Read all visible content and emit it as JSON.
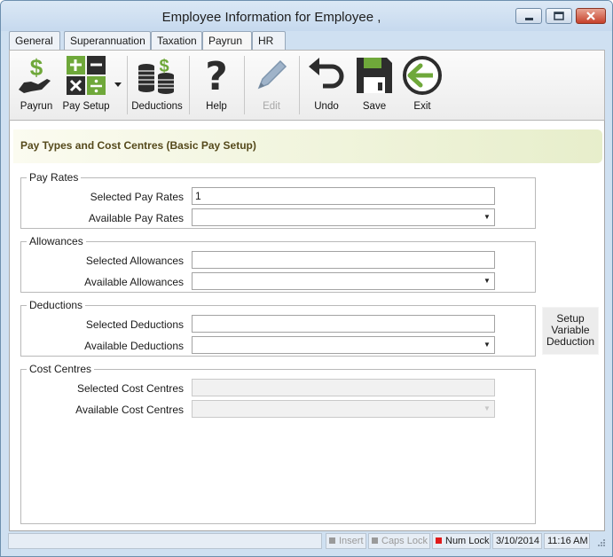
{
  "window": {
    "title": "Employee Information for  Employee ,",
    "controls": [
      "minimize",
      "maximize",
      "close"
    ]
  },
  "tabs": [
    {
      "label": "General",
      "active": false
    },
    {
      "label": "Superannuation",
      "active": false
    },
    {
      "label": "Taxation",
      "active": false
    },
    {
      "label": "Payrun",
      "active": true
    },
    {
      "label": "HR",
      "active": false
    }
  ],
  "toolbar": {
    "payrun": {
      "label": "Payrun",
      "icon": "hand-dollar-icon"
    },
    "pay_setup": {
      "label": "Pay Setup",
      "icon": "calculator-icon"
    },
    "deductions": {
      "label": "Deductions",
      "icon": "coin-stack-icon"
    },
    "help": {
      "label": "Help",
      "icon": "question-mark-icon"
    },
    "edit": {
      "label": "Edit",
      "icon": "pencil-icon",
      "disabled": true
    },
    "undo": {
      "label": "Undo",
      "icon": "undo-arrow-icon"
    },
    "save": {
      "label": "Save",
      "icon": "floppy-disk-icon"
    },
    "exit": {
      "label": "Exit",
      "icon": "exit-arrow-icon"
    }
  },
  "header": {
    "title": "Pay Types and Cost Centres (Basic Pay Setup)"
  },
  "pay_rates": {
    "legend": "Pay Rates",
    "selected_label": "Selected Pay Rates",
    "selected_value": "1",
    "available_label": "Available Pay Rates",
    "available_value": ""
  },
  "allowances": {
    "legend": "Allowances",
    "selected_label": "Selected Allowances",
    "selected_value": "",
    "available_label": "Available Allowances",
    "available_value": ""
  },
  "deductions_group": {
    "legend": "Deductions",
    "selected_label": "Selected Deductions",
    "selected_value": "",
    "available_label": "Available Deductions",
    "available_value": ""
  },
  "cost_centres": {
    "legend": "Cost Centres",
    "selected_label": "Selected Cost Centres",
    "selected_value": "",
    "available_label": "Available Cost Centres",
    "available_value": ""
  },
  "setup_variable_deduction": {
    "line1": "Setup",
    "line2": "Variable",
    "line3": "Deduction"
  },
  "statusbar": {
    "insert": "Insert",
    "caps_lock": "Caps Lock",
    "num_lock": "Num Lock",
    "date": "3/10/2014",
    "time": "11:16 AM"
  },
  "colors": {
    "window_frame": "#cfe0f1",
    "header_text": "#55491b",
    "header_gradient_end": "#e7eecb",
    "num_lock_on": "#e01b1b",
    "indicator_off": "#9a9a9a",
    "icon_dark": "#2d2d2d",
    "icon_green": "#6fa83a"
  }
}
